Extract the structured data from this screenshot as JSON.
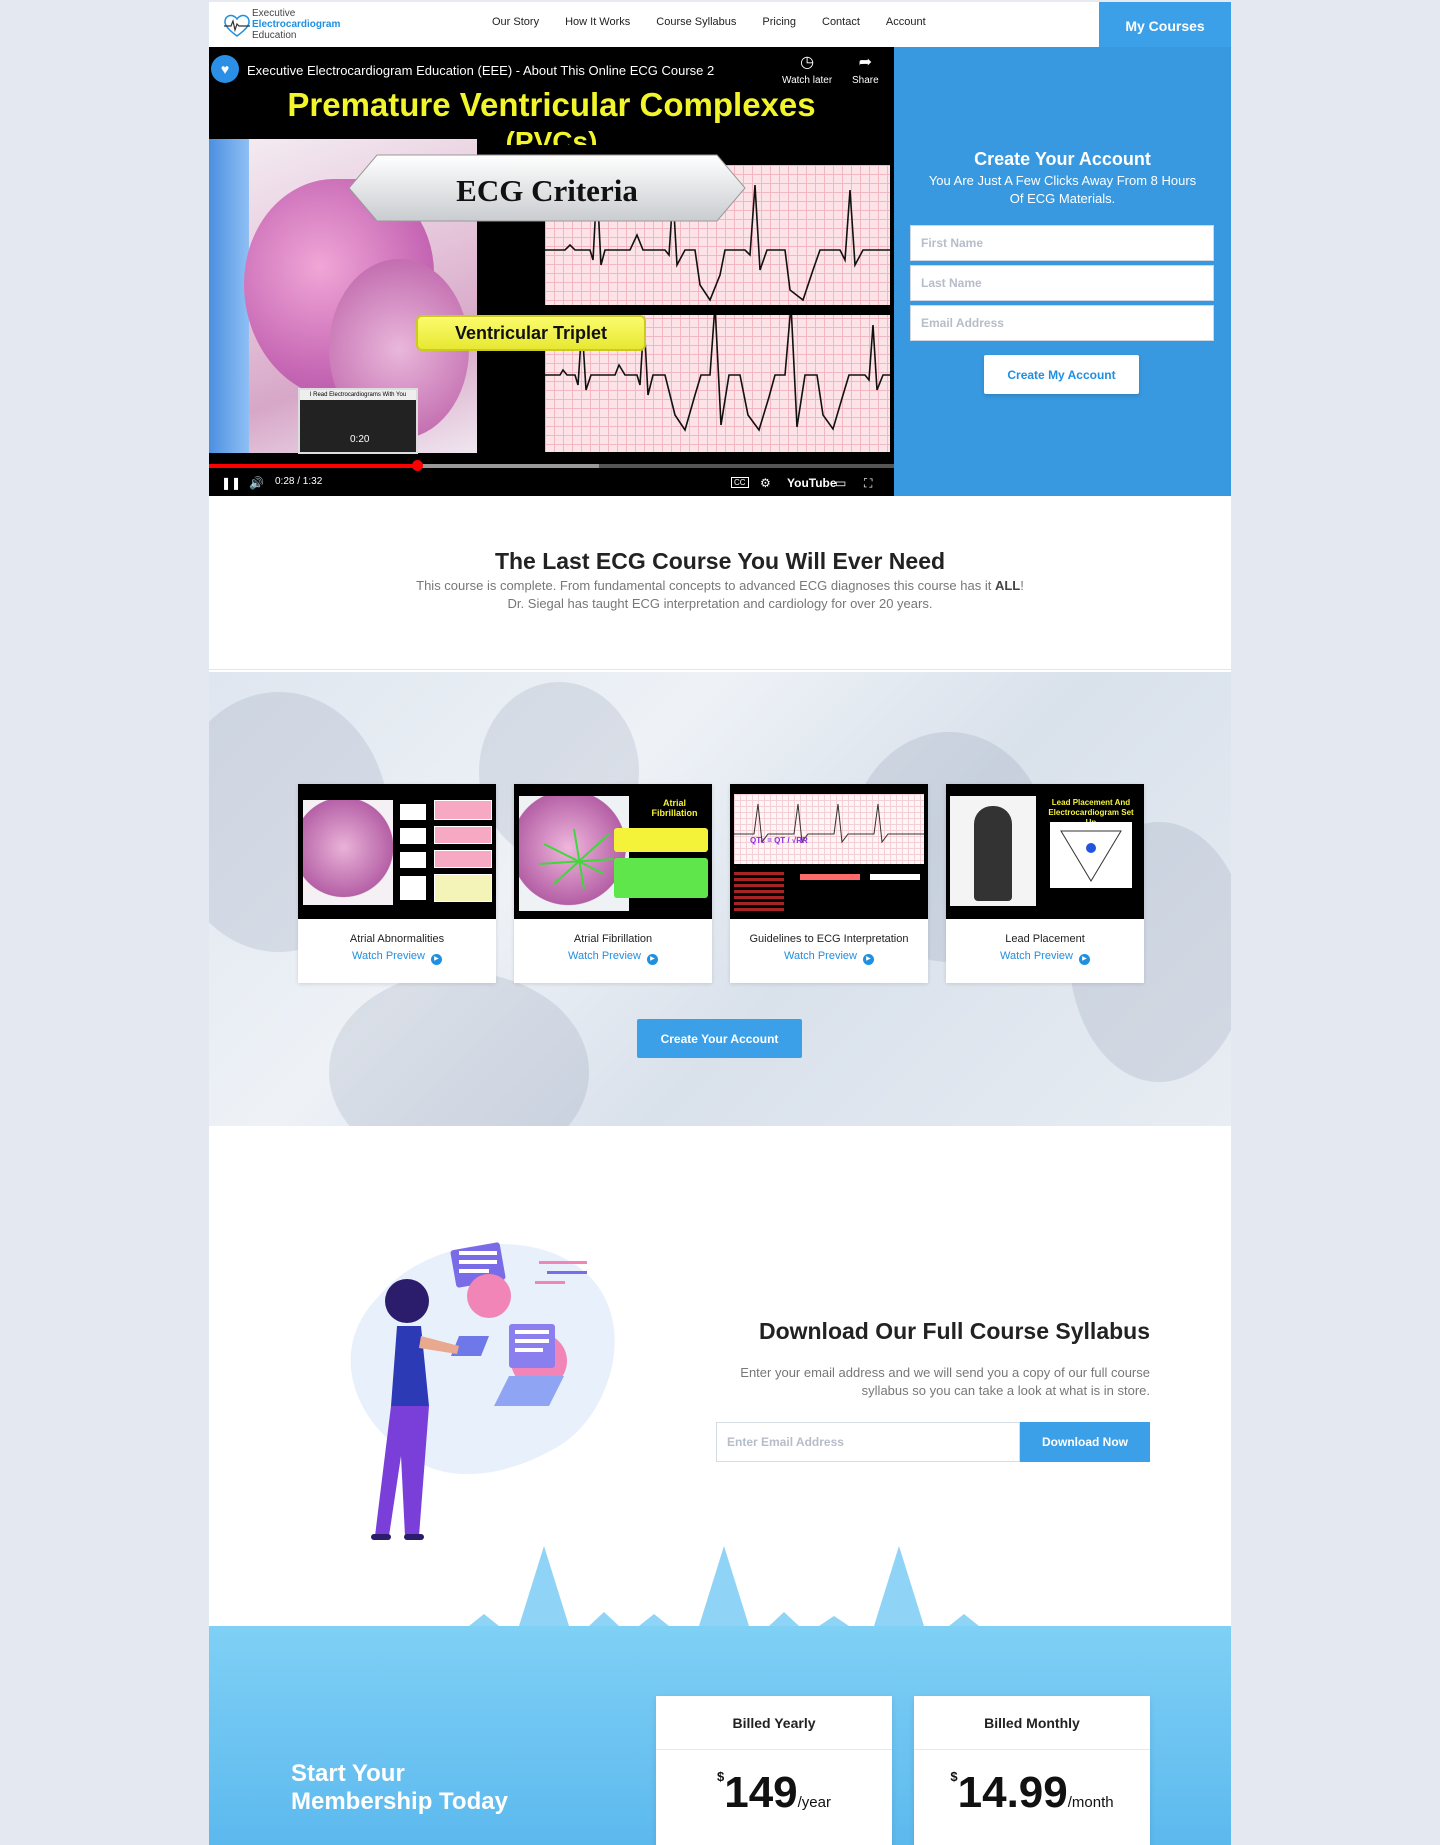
{
  "brand": {
    "line1": "Executive",
    "line2": "Electrocardiogram",
    "line3": "Education",
    "accent": "#3ba0e8"
  },
  "nav": {
    "items": [
      "Our Story",
      "How It Works",
      "Course Syllabus",
      "Pricing",
      "Contact",
      "Account"
    ],
    "cta": "My Courses"
  },
  "video": {
    "title": "Executive Electrocardiogram Education (EEE) - About This Online ECG Course 2",
    "watch_later": "Watch later",
    "share": "Share",
    "slide_title_1": "Premature Ventricular Complexes",
    "slide_title_2": "(PVCs)",
    "criteria_label": "ECG Criteria",
    "triplet_label": "Ventricular Triplet",
    "thumb_caption": "I Read Electrocardiograms With You",
    "thumb_time": "0:20",
    "time": "0:28 / 1:32",
    "progress": 0.3043,
    "youtube": "YouTube"
  },
  "signup": {
    "title": "Create Your Account",
    "subtitle": "You Are Just A Few Clicks Away From 8 Hours Of ECG Materials.",
    "first_name_placeholder": "First Name",
    "last_name_placeholder": "Last Name",
    "email_placeholder": "Email Address",
    "button": "Create My Account"
  },
  "intro": {
    "title": "The Last ECG Course You Will Ever Need",
    "line1_pre": "This course is complete. From fundamental concepts to advanced ECG diagnoses this course has it ",
    "line1_bold": "ALL",
    "line1_post": "!",
    "line2": "Dr. Siegal has taught ECG interpretation and cardiology for over 20 years."
  },
  "previews": {
    "cards": [
      {
        "name": "Atrial Abnormalities",
        "watch": "Watch Preview",
        "title": ""
      },
      {
        "name": "Atrial Fibrillation",
        "watch": "Watch Preview",
        "title": "Atrial Fibrillation"
      },
      {
        "name": "Guidelines to ECG Interpretation",
        "watch": "Watch Preview",
        "title": "QTc = QT / √RR"
      },
      {
        "name": "Lead Placement",
        "watch": "Watch Preview",
        "title": "Lead Placement And Electrocardiogram Set Up"
      }
    ],
    "cta": "Create Your Account"
  },
  "syllabus": {
    "title": "Download Our Full Course Syllabus",
    "description": "Enter your email address and we will send you a copy of our full course syllabus so you can take a look at what is in store.",
    "email_placeholder": "Enter Email Address",
    "button": "Download Now"
  },
  "membership": {
    "title_1": "Start Your",
    "title_2": "Membership Today",
    "plans": [
      {
        "label": "Billed Yearly",
        "currency": "$",
        "price": "149",
        "period": "/year"
      },
      {
        "label": "Billed Monthly",
        "currency": "$",
        "price": "14.99",
        "period": "/month"
      }
    ]
  }
}
